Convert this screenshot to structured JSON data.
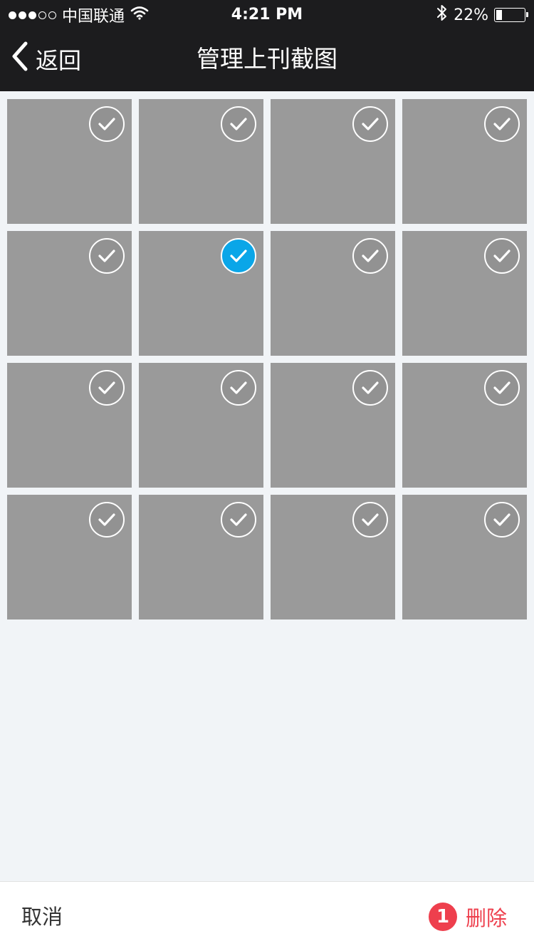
{
  "status_bar": {
    "carrier": "中国联通",
    "time": "4:21 PM",
    "battery": "22%",
    "battery_level": 0.22,
    "signal_strength": 3,
    "signal_max": 5
  },
  "nav": {
    "back_label": "返回",
    "title": "管理上刊截图"
  },
  "grid": {
    "rows": 4,
    "columns": 4,
    "selected_indices": [
      5
    ]
  },
  "bottom_bar": {
    "cancel_label": "取消",
    "delete_label": "删除",
    "selected_count": "1"
  },
  "colors": {
    "nav_background": "#1c1c1e",
    "page_background": "#f1f4f7",
    "thumbnail": "#9a9a9a",
    "selected_check": "#0aa6e8",
    "delete_red": "#ee3f4d"
  }
}
